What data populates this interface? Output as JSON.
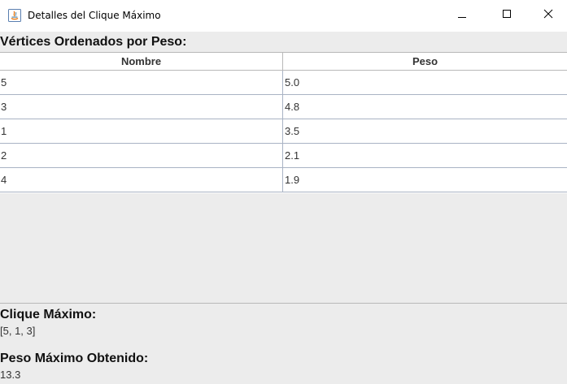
{
  "window": {
    "title": "Detalles del Clique Máximo",
    "icon": "java-app-icon",
    "controls": {
      "minimize": "minimize-icon",
      "maximize": "maximize-icon",
      "close": "close-icon"
    }
  },
  "vertices": {
    "heading": "Vértices Ordenados por Peso:",
    "columns": [
      "Nombre",
      "Peso"
    ],
    "rows": [
      [
        "5",
        "5.0"
      ],
      [
        "3",
        "4.8"
      ],
      [
        "1",
        "3.5"
      ],
      [
        "2",
        "2.1"
      ],
      [
        "4",
        "1.9"
      ]
    ]
  },
  "clique": {
    "heading": "Clique Máximo:",
    "value": "[5, 1, 3]"
  },
  "peso": {
    "heading": "Peso Máximo Obtenido:",
    "value": "13.3"
  }
}
